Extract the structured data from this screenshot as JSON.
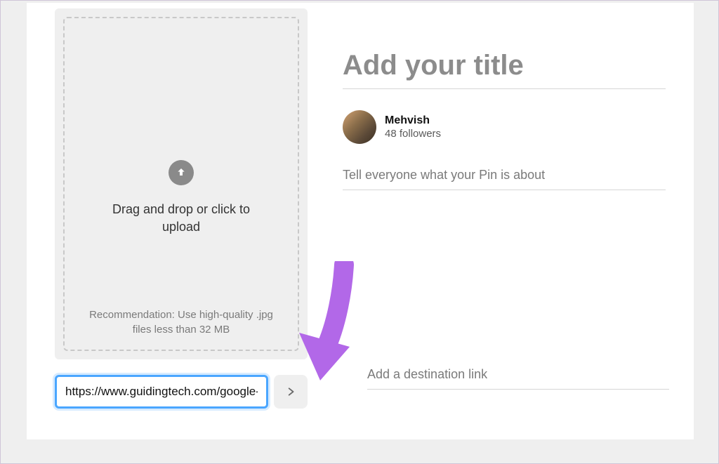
{
  "upload": {
    "instruction": "Drag and drop or click to upload",
    "recommendation": "Recommendation: Use high-quality .jpg files less than 32 MB"
  },
  "urlField": {
    "value": "https://www.guidingtech.com/google-"
  },
  "titleField": {
    "placeholder": "Add your title",
    "value": ""
  },
  "user": {
    "name": "Mehvish",
    "followers": "48 followers"
  },
  "descField": {
    "placeholder": "Tell everyone what your Pin is about",
    "value": ""
  },
  "destField": {
    "placeholder": "Add a destination link",
    "value": ""
  },
  "annotation": {
    "arrowColor": "#b268e8"
  }
}
